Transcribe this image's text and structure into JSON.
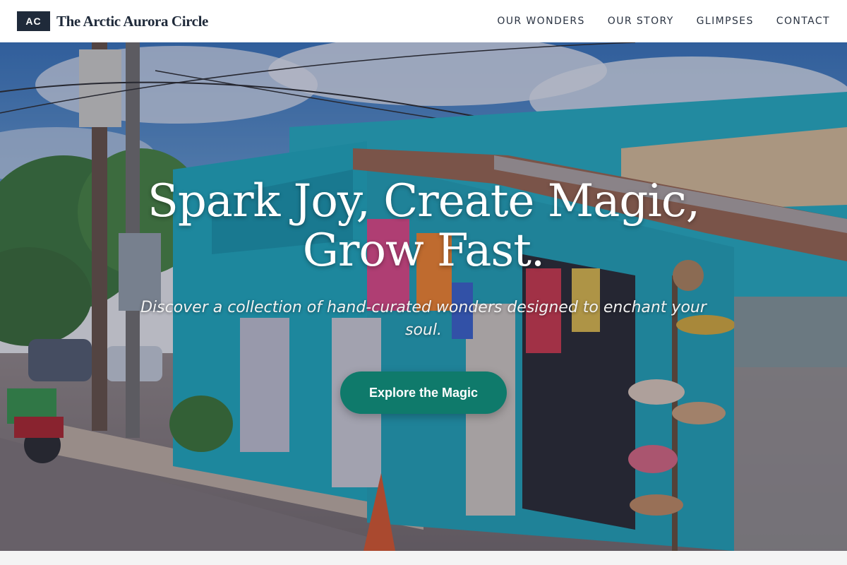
{
  "header": {
    "logo_mark": "AC",
    "brand_name": "The Arctic Aurora Circle",
    "nav": [
      {
        "label": "OUR WONDERS"
      },
      {
        "label": "OUR STORY"
      },
      {
        "label": "GLIMPSES"
      },
      {
        "label": "CONTACT"
      }
    ]
  },
  "hero": {
    "title_line1": "Spark Joy, Create Magic,",
    "title_line2": "Grow Fast.",
    "subtitle": "Discover a collection of hand-curated wonders designed to enchant your soul.",
    "cta_label": "Explore the Magic",
    "image_subject": "colorful turquoise souvenir shop on a street corner",
    "colors": {
      "cta": "#0f7a6b",
      "shop_wall": "#1fb0c2",
      "sky": "#3f7fc4"
    }
  }
}
